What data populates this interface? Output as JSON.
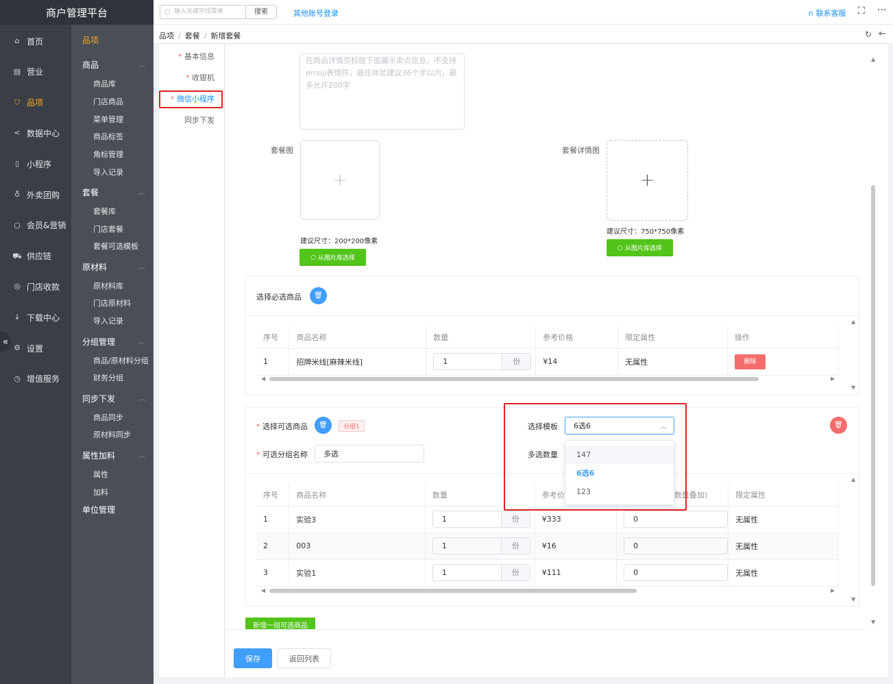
{
  "app": {
    "title": "商户管理平台"
  },
  "topbar": {
    "search_placeholder": "输入关键字找菜单",
    "search_button": "搜索",
    "other_login": "其他账号登录",
    "contact": "联系客服"
  },
  "nav_primary": [
    {
      "label": "首页",
      "icon": "home-icon"
    },
    {
      "label": "营业",
      "icon": "business-icon"
    },
    {
      "label": "品项",
      "icon": "bag-icon"
    },
    {
      "label": "数据中心",
      "icon": "share-icon"
    },
    {
      "label": "小程序",
      "icon": "phone-icon"
    },
    {
      "label": "外卖团购",
      "icon": "bike-icon"
    },
    {
      "label": "会员&营销",
      "icon": "user-icon"
    },
    {
      "label": "供应链",
      "icon": "truck-icon"
    },
    {
      "label": "门店收款",
      "icon": "coins-icon"
    },
    {
      "label": "下载中心",
      "icon": "download-icon"
    },
    {
      "label": "设置",
      "icon": "settings-icon"
    },
    {
      "label": "增值服务",
      "icon": "clock-icon"
    }
  ],
  "nav_secondary": {
    "header": "品项",
    "groups": [
      {
        "label": "商品",
        "items": [
          "商品库",
          "门店商品",
          "菜单管理",
          "商品标签",
          "角标管理",
          "导入记录"
        ]
      },
      {
        "label": "套餐",
        "items": [
          "套餐库",
          "门店套餐",
          "套餐可选模板"
        ]
      },
      {
        "label": "原材料",
        "items": [
          "原材料库",
          "门店原材料",
          "导入记录"
        ]
      },
      {
        "label": "分组管理",
        "items": [
          "商品/原材料分组",
          "财务分组"
        ]
      },
      {
        "label": "同步下发",
        "items": [
          "商品同步",
          "原材料同步"
        ]
      },
      {
        "label": "属性加料",
        "items": [
          "属性",
          "加料"
        ]
      },
      {
        "label": "单位管理",
        "items": []
      }
    ]
  },
  "breadcrumb": [
    "品项",
    "套餐",
    "新增套餐"
  ],
  "left_tabs": [
    {
      "label": "基本信息",
      "required": true
    },
    {
      "label": "收银机",
      "required": true
    },
    {
      "label": "微信小程序",
      "required": true
    },
    {
      "label": "同步下发",
      "required": false
    }
  ],
  "form": {
    "description_placeholder": "在商品详情页标题下面展示卖点信息，不支持emoji表情符，最佳体验建议36个字以内，最多允许200字",
    "package_image_label": "套餐图",
    "package_detail_image_label": "套餐详情图",
    "package_image_hint": "建议尺寸：200*200像素",
    "package_detail_image_hint": "建议尺寸：750*750像素",
    "from_library_button": "从图片库选择",
    "plus": "+",
    "required_section_label": "选择必选商品",
    "optional_section_label": "选择可选商品",
    "group_tag": "分组1",
    "optional_group_name_label": "可选分组名称",
    "optional_group_name_value": "多选",
    "template_label": "选择模板",
    "template_value": "6选6",
    "multi_count_label": "多选数量",
    "template_options": [
      "147",
      "6选6",
      "123"
    ],
    "add_group_button": "新增一组可选商品",
    "save_button": "保存",
    "back_button": "返回列表",
    "unit": "份",
    "delete_label": "删除"
  },
  "required_table": {
    "headers": [
      "序号",
      "商品名称",
      "数量",
      "参考价格",
      "限定属性",
      "操作"
    ],
    "rows": [
      {
        "no": "1",
        "name": "招牌米线[麻辣米线]",
        "qty": "1",
        "price": "¥14",
        "attr": "无属性"
      }
    ]
  },
  "optional_table": {
    "headers": [
      "序号",
      "商品名称",
      "数量",
      "参考价",
      "数量叠加)",
      "限定属性"
    ],
    "rows": [
      {
        "no": "1",
        "name": "实验3",
        "qty": "1",
        "price": "¥333",
        "extra": "0",
        "attr": "无属性"
      },
      {
        "no": "2",
        "name": "003",
        "qty": "1",
        "price": "¥16",
        "extra": "0",
        "attr": "无属性"
      },
      {
        "no": "3",
        "name": "实验1",
        "qty": "1",
        "price": "¥111",
        "extra": "0",
        "attr": "无属性"
      }
    ]
  },
  "colors": {
    "accent": "#409eff",
    "active_nav": "#f5a623",
    "danger": "#f56c6c",
    "success": "#52c41a",
    "highlight_box": "#e02020"
  }
}
